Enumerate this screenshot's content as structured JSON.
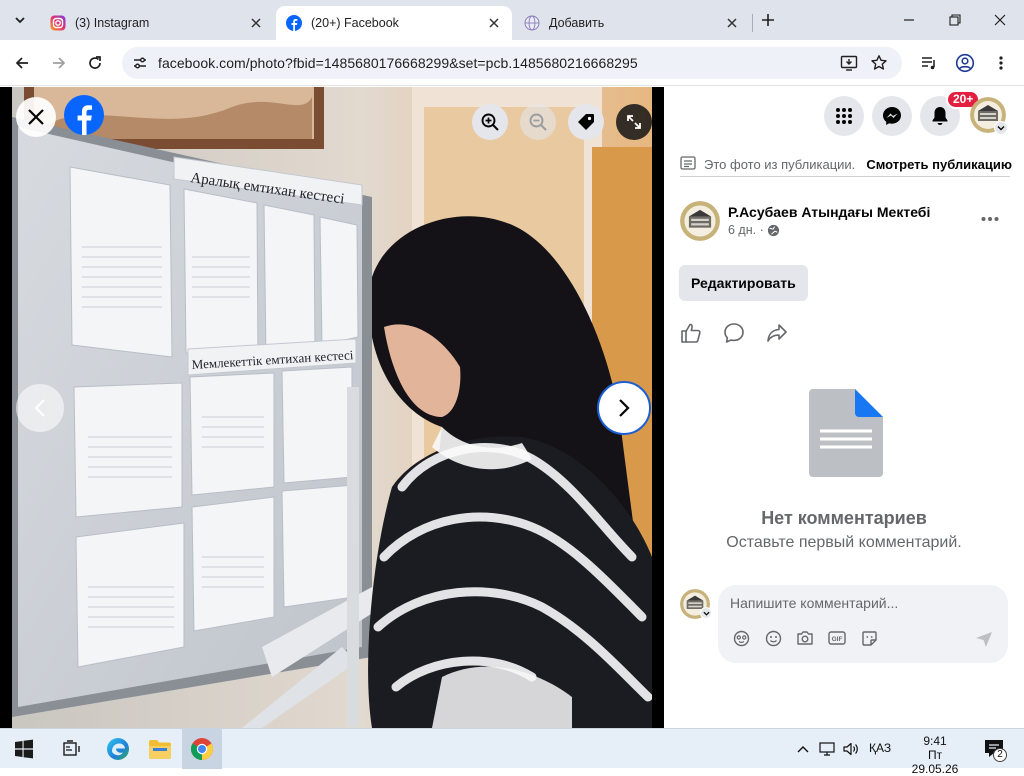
{
  "browser": {
    "tabs": [
      {
        "title": "(3) Instagram",
        "active": false,
        "favicon": "instagram-favicon"
      },
      {
        "title": "(20+) Facebook",
        "active": true,
        "favicon": "facebook-favicon"
      },
      {
        "title": "Добавить",
        "active": false,
        "favicon": "globe-favicon"
      }
    ],
    "url": "facebook.com/photo?fbid=1485680176668299&set=pcb.1485680216668295"
  },
  "viewer": {
    "photo_board_text_1": "Аралық емтихан кестесі",
    "photo_board_text_2": "Мемлекеттік емтихан кестесі"
  },
  "panel": {
    "notification_badge": "20+",
    "origin_text": "Это фото из публикации.",
    "origin_link": "Смотреть публикацию",
    "author_name": "Р.Асубаев Атындағы Мектебі",
    "post_time": "6 дн. ·",
    "edit_label": "Редактировать",
    "empty_title": "Нет комментариев",
    "empty_subtitle": "Оставьте первый комментарий.",
    "comment_placeholder": "Напишите комментарий..."
  },
  "taskbar": {
    "language": "ҚАЗ",
    "time": "9:41",
    "date": "Пт 29.05.26",
    "notification_count": "2"
  },
  "colors": {
    "facebook_blue": "#0866ff",
    "badge_red": "#e41e3f",
    "panel_gray": "#e4e6eb",
    "tab_strip": "#dfe3ec"
  }
}
